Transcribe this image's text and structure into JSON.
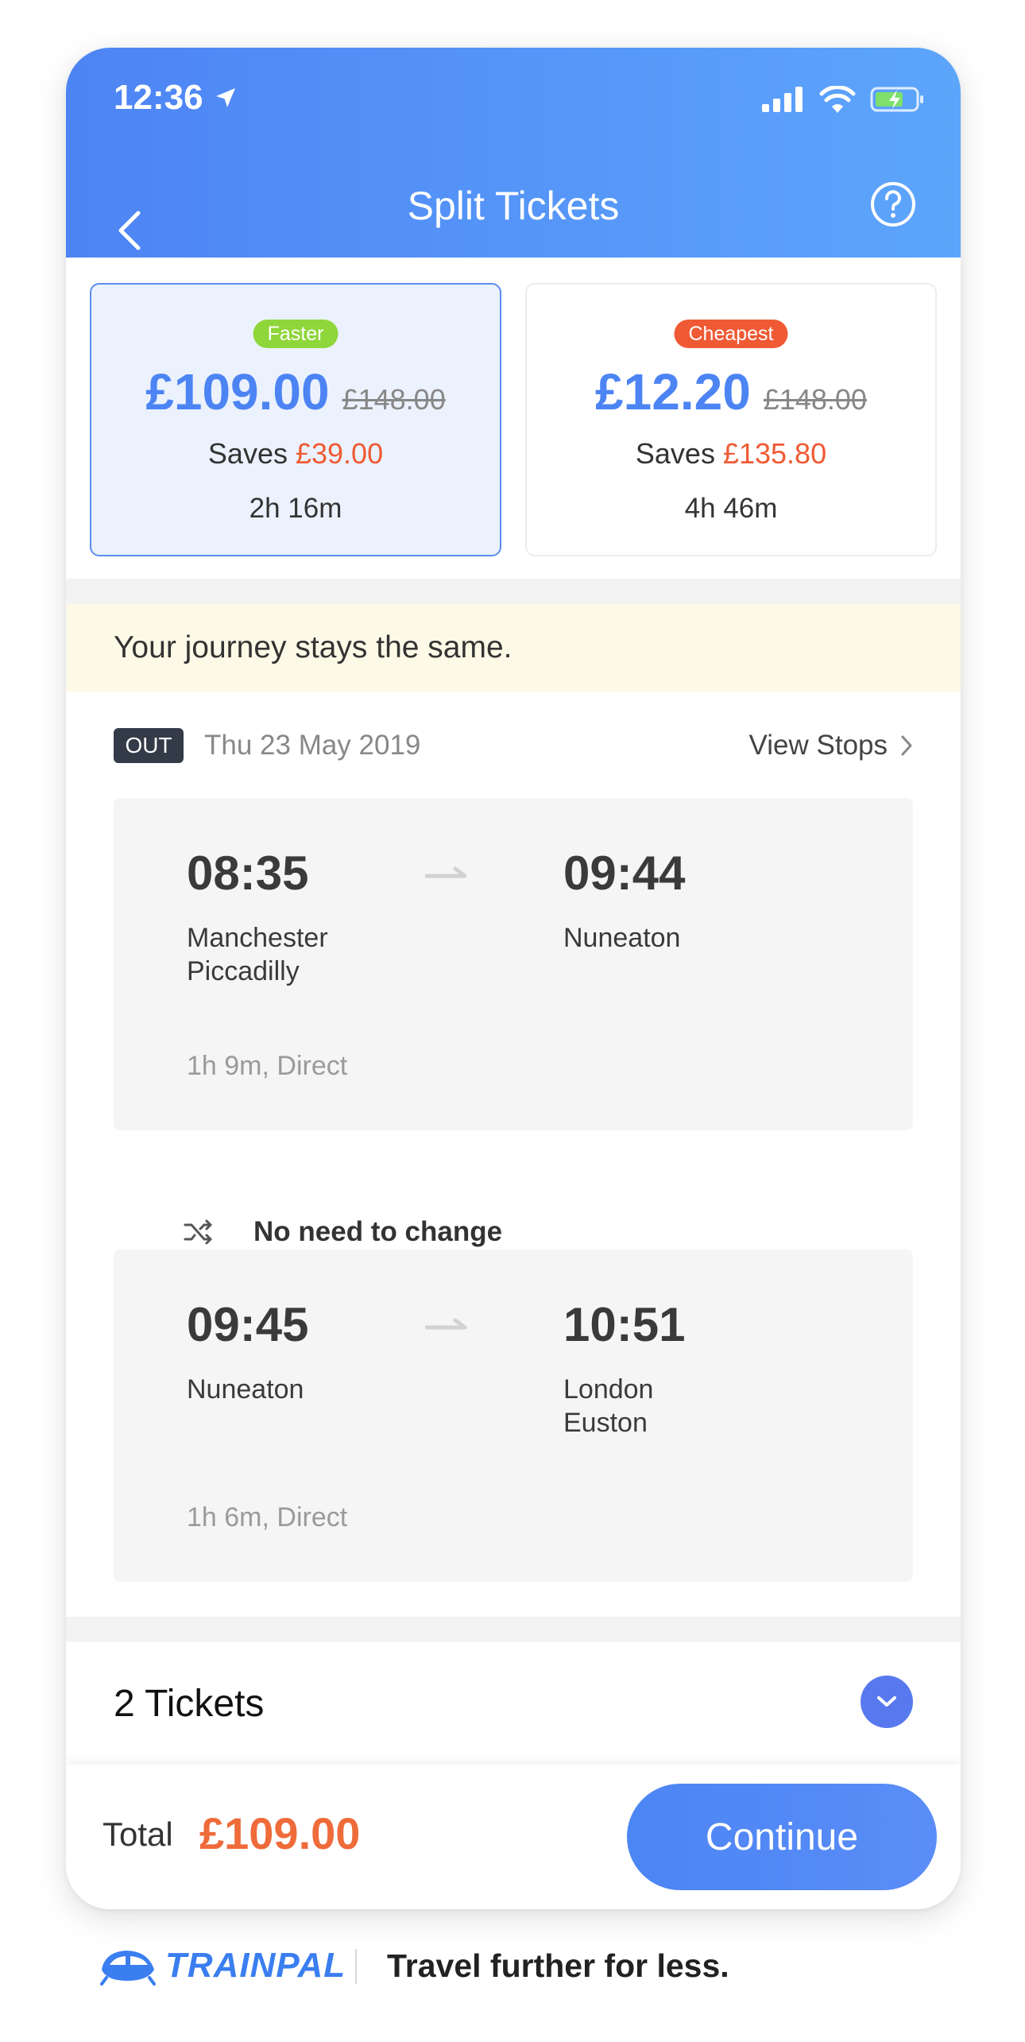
{
  "status_bar": {
    "time": "12:36"
  },
  "nav": {
    "title": "Split Tickets"
  },
  "fares": [
    {
      "badge": "Faster",
      "badge_color": "#8fd63a",
      "price": "£109.00",
      "original_price": "£148.00",
      "saves_label": "Saves",
      "saves_amount": "£39.00",
      "duration": "2h 16m",
      "selected": true
    },
    {
      "badge": "Cheapest",
      "badge_color": "#ef5a34",
      "price": "£12.20",
      "original_price": "£148.00",
      "saves_label": "Saves",
      "saves_amount": "£135.80",
      "duration": "4h 46m",
      "selected": false
    }
  ],
  "notice": "Your journey stays the same.",
  "journey": {
    "direction": "OUT",
    "date": "Thu 23 May 2019",
    "view_stops": "View Stops",
    "legs": [
      {
        "dep_time": "08:35",
        "dep_station_line1": "Manchester",
        "dep_station_line2": "Piccadilly",
        "arr_time": "09:44",
        "arr_station_line1": "Nuneaton",
        "arr_station_line2": "",
        "info": "1h 9m, Direct"
      },
      {
        "dep_time": "09:45",
        "dep_station_line1": "Nuneaton",
        "dep_station_line2": "",
        "arr_time": "10:51",
        "arr_station_line1": "London",
        "arr_station_line2": "Euston",
        "info": "1h 6m, Direct"
      }
    ],
    "change_text": "No need to change"
  },
  "tickets": {
    "title": "2 Tickets"
  },
  "footer": {
    "total_label": "Total",
    "total_amount": "£109.00",
    "continue_label": "Continue"
  },
  "brand": {
    "name": "TRAINPAL",
    "tagline": "Travel further for less."
  },
  "colors": {
    "primary": "#4d84f4",
    "accent_orange": "#ef6b3a",
    "notice_bg": "#fcfae7"
  }
}
